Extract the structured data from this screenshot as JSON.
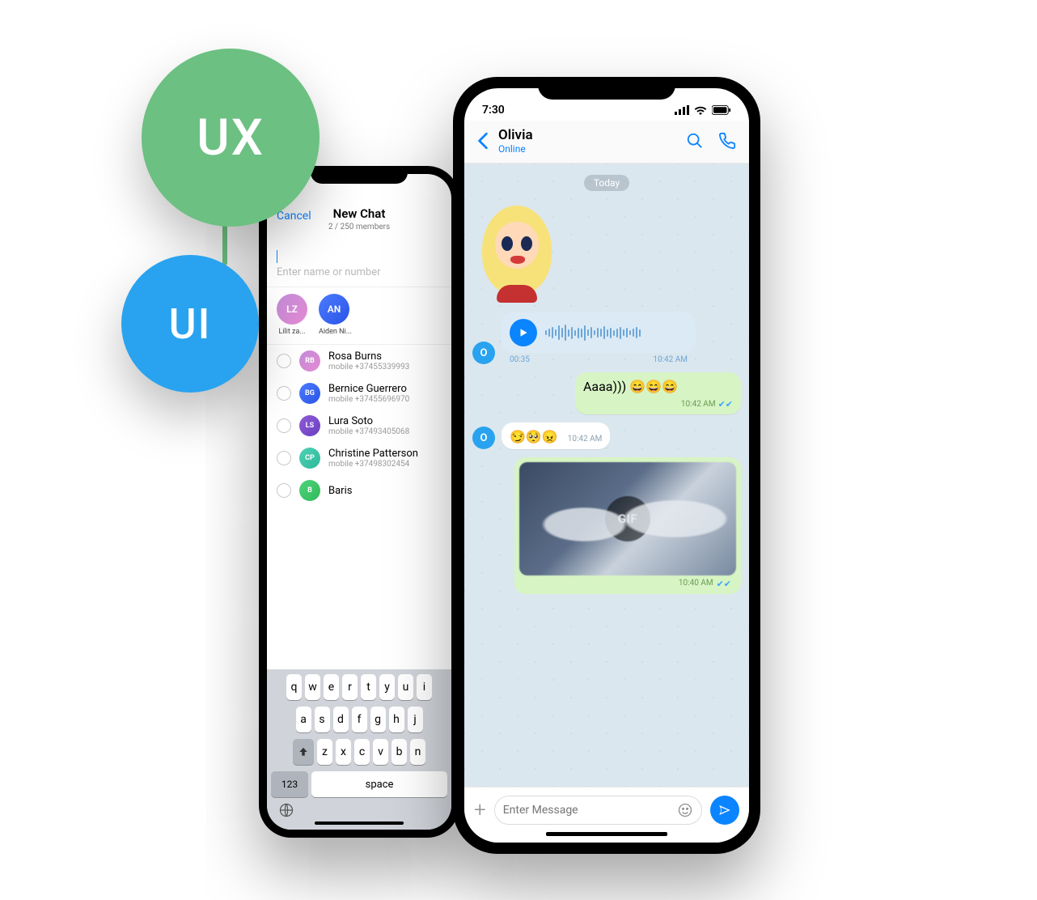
{
  "badges": {
    "ux": "UX",
    "ui": "UI"
  },
  "colors": {
    "accent_blue": "#0b84ff",
    "ux_green": "#6cc082",
    "ui_blue": "#29a3ef",
    "bubble_out": "#d7f4c4"
  },
  "phone_left": {
    "header": {
      "cancel": "Cancel",
      "title": "New Chat",
      "subtitle": "2 / 250 members"
    },
    "search_placeholder": "Enter name or number",
    "selected": [
      {
        "initials": "LZ",
        "name": "Lilit za..."
      },
      {
        "initials": "AN",
        "name": "Aiden Ni..."
      }
    ],
    "contacts": [
      {
        "initials": "RB",
        "name": "Rosa Burns",
        "phone": "mobile +37455339993"
      },
      {
        "initials": "BG",
        "name": "Bernice Guerrero",
        "phone": "mobile +37455696970"
      },
      {
        "initials": "LS",
        "name": "Lura Soto",
        "phone": "mobile +37493405068"
      },
      {
        "initials": "CP",
        "name": "Christine Patterson",
        "phone": "mobile +37498302454"
      },
      {
        "initials": "B",
        "name": "Baris",
        "phone": ""
      }
    ],
    "keyboard": {
      "row1": [
        "q",
        "w",
        "e",
        "r",
        "t",
        "y",
        "u",
        "i"
      ],
      "row2": [
        "a",
        "s",
        "d",
        "f",
        "g",
        "h",
        "j"
      ],
      "row3": [
        "z",
        "x",
        "c",
        "v",
        "b",
        "n"
      ],
      "num_key": "123",
      "space_key": "space"
    }
  },
  "phone_right": {
    "status_time": "7:30",
    "header": {
      "name": "Olivia",
      "status": "Online"
    },
    "date_pill": "Today",
    "sender_initial": "O",
    "voice": {
      "duration": "00:35",
      "time": "10:42 AM"
    },
    "msg_out_text": "Aaaa))) ",
    "msg_out_emojis": "😄😄😄",
    "msg_out_time": "10:42 AM",
    "msg_in_emojis": "😏🥺😠",
    "msg_in_time": "10:42 AM",
    "gif_label": "GIF",
    "gif_time": "10:40 AM",
    "composer_placeholder": "Enter Message"
  }
}
